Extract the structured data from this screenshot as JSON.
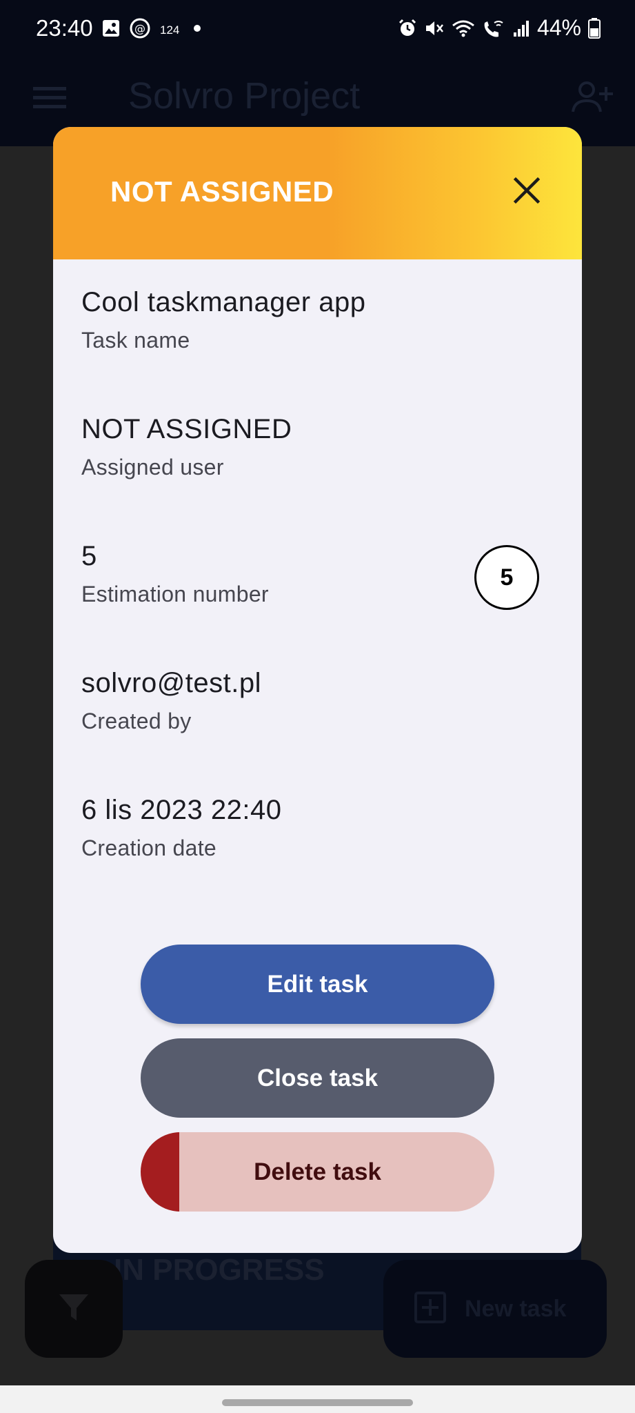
{
  "status_bar": {
    "time": "23:40",
    "notification_count": "124",
    "battery": "44%",
    "icons": [
      "image-icon",
      "threads-icon",
      "dot-icon",
      "alarm-icon",
      "mute-icon",
      "wifi-icon",
      "wifi-call-icon",
      "signal-icon",
      "battery-icon"
    ]
  },
  "app_bar": {
    "title": "Solvro Project",
    "menu_icon": "menu-icon",
    "add_user_icon": "add-user-icon"
  },
  "background": {
    "column_label": "IN PROGRESS",
    "new_task_label": "New task",
    "filter_icon": "filter-icon",
    "add_icon": "plus-square-icon"
  },
  "dialog": {
    "title": "NOT ASSIGNED",
    "header_colors": [
      "#f7a128",
      "#fde53c"
    ],
    "fields": [
      {
        "value": "Cool taskmanager app",
        "label": "Task name"
      },
      {
        "value": "NOT ASSIGNED",
        "label": "Assigned user"
      },
      {
        "value": "5",
        "label": "Estimation number"
      },
      {
        "value": "solvro@test.pl",
        "label": "Created by"
      },
      {
        "value": "6 lis 2023 22:40",
        "label": "Creation date"
      }
    ],
    "estimation_badge": "5",
    "buttons": {
      "edit": "Edit task",
      "close": "Close task",
      "delete": "Delete task"
    },
    "delete_hold_progress": 0.11,
    "colors": {
      "edit": "#3b5ca8",
      "close": "#575c6d",
      "delete_bg": "#e6c1be",
      "delete_fill": "#a41d1f"
    }
  }
}
